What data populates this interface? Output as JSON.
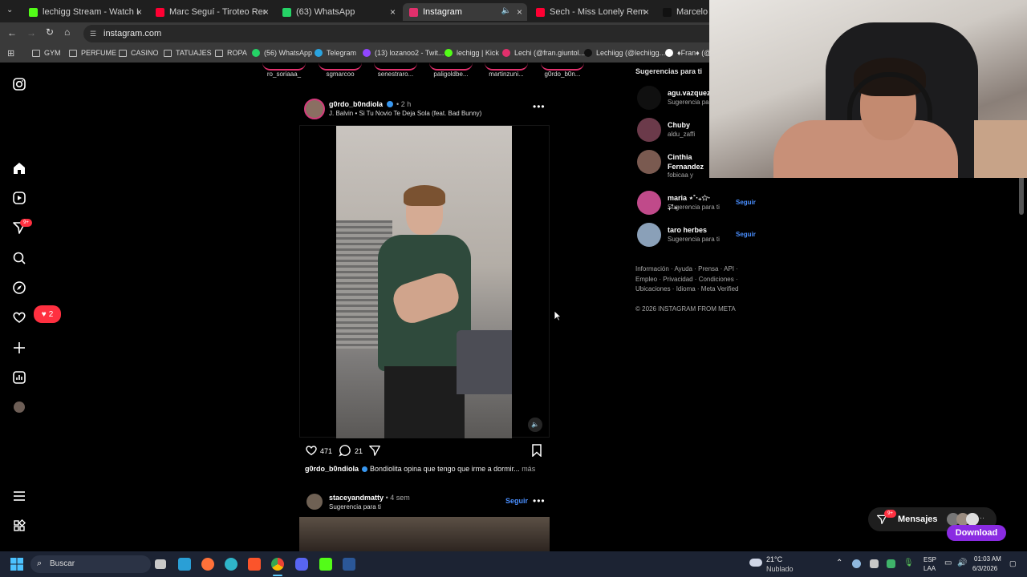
{
  "browser": {
    "tabs": [
      {
        "label": "lechigg Stream - Watch Live on",
        "color": "#53fc18"
      },
      {
        "label": "Marc Seguí - Tiroteo Remix ft. F",
        "color": "#ff0033"
      },
      {
        "label": "(63) WhatsApp",
        "color": "#25d366"
      },
      {
        "label": "Instagram",
        "color": "#e1306c"
      },
      {
        "label": "Sech - Miss Lonely Remix ft. Ju",
        "color": "#ff0033"
      },
      {
        "label": "Marcelo zeta",
        "color": "#111111"
      }
    ],
    "url": "instagram.com",
    "bookmarks": [
      "GYM",
      "PERFUME",
      "CASINO",
      "TATUAJES",
      "ROPA",
      "(56) WhatsApp",
      "Telegram",
      "(13) lozanoo2 - Twit...",
      "lechigg | Kick",
      "Lechi (@fran.giuntol...",
      "Lechiigg (@lechiigg...",
      "♦Fran♦ (@"
    ]
  },
  "sidebar": {
    "notifications_badge": "9+",
    "likes_count": "2"
  },
  "stories": [
    "ro_soriaaa_",
    "sgmarcoo",
    "senestraro...",
    "paligoldbe...",
    "martinzuni...",
    "g0rdo_b0n..."
  ],
  "post": {
    "username": "g0rdo_b0ndiola",
    "time": "2 h",
    "separator": "•",
    "audio": "J. Balvin • Si Tu Novio Te Deja Sola (feat. Bad Bunny)",
    "likes": "471",
    "comments": "21",
    "caption_user": "g0rdo_b0ndiola",
    "caption": "Bondiolita opina que tengo que irme a dormir...",
    "more": "más"
  },
  "next_post": {
    "username": "staceyandmatty",
    "time": "4 sem",
    "subtitle": "Sugerencia para ti",
    "follow": "Seguir"
  },
  "suggestions": {
    "title": "Sugerencias para ti",
    "items": [
      {
        "name": "agu.vazquez",
        "sub": "Sugerencia par",
        "follow": ""
      },
      {
        "name": "Chuby",
        "sub": "aldu_zaffi",
        "follow": ""
      },
      {
        "name": "Cinthia Fernandez",
        "sub": "fobicaa y",
        "follow": ""
      },
      {
        "name": "maria ⋆˚‧₊✩‧₊˚⋆",
        "sub": "Sugerencia para ti",
        "follow": "Seguir"
      },
      {
        "name": "taro herbes",
        "sub": "Sugerencia para ti",
        "follow": "Seguir"
      }
    ],
    "footer_links": [
      "Información · Ayuda · Prensa · API ·",
      "Empleo · Privacidad · Condiciones ·",
      "Ubicaciones · Idioma · Meta Verified"
    ],
    "copyright": "© 2026 INSTAGRAM FROM META"
  },
  "messages": {
    "label": "Mensajes",
    "badge": "9+",
    "download": "Download"
  },
  "taskbar": {
    "search": "Buscar",
    "weather_temp": "21°C",
    "weather_desc": "Nublado",
    "lang1": "ESP",
    "lang2": "LAA",
    "time": "01:03 AM",
    "date": "6/3/2026"
  }
}
